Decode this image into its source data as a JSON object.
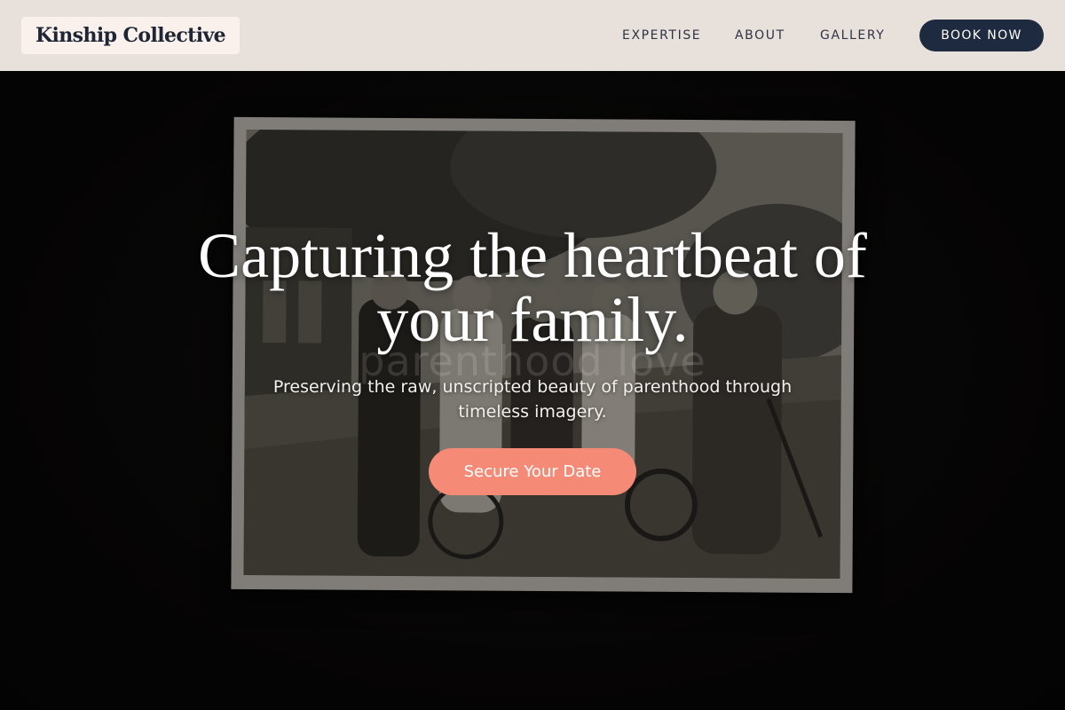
{
  "header": {
    "logo": "Kinship Collective",
    "nav": {
      "expertise": "EXPERTISE",
      "about": "ABOUT",
      "gallery": "GALLERY"
    },
    "book_button": "BOOK NOW"
  },
  "hero": {
    "headline": "Capturing the heartbeat of your family.",
    "subtitle": "Preserving the raw, unscripted beauty of parenthood through timeless imagery.",
    "watermark": "parenthood love",
    "cta": "Secure Your Date"
  },
  "colors": {
    "header_bg": "#e8e0db",
    "brand_navy": "#1e2a3f",
    "accent_coral": "#f58a76",
    "hero_bg": "#0a0909"
  }
}
